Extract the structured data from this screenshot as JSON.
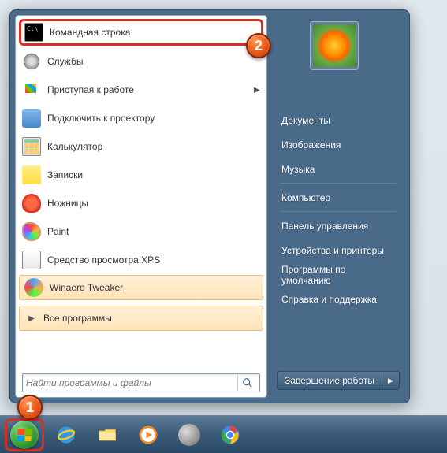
{
  "programs": [
    {
      "label": "Командная строка",
      "icon": "cmd",
      "highlighted": true
    },
    {
      "label": "Службы",
      "icon": "gear"
    },
    {
      "label": "Приступая к работе",
      "icon": "flag",
      "arrow": true
    },
    {
      "label": "Подключить к проектору",
      "icon": "proj"
    },
    {
      "label": "Калькулятор",
      "icon": "calc"
    },
    {
      "label": "Записки",
      "icon": "note"
    },
    {
      "label": "Ножницы",
      "icon": "snip"
    },
    {
      "label": "Paint",
      "icon": "paint"
    },
    {
      "label": "Средство просмотра XPS",
      "icon": "xps"
    },
    {
      "label": "Winaero Tweaker",
      "icon": "tweak",
      "pinned": true
    }
  ],
  "all_programs": {
    "label": "Все программы"
  },
  "search": {
    "placeholder": "Найти программы и файлы"
  },
  "right": {
    "username": "",
    "items": [
      "Документы",
      "Изображения",
      "Музыка",
      "Компьютер",
      "Панель управления",
      "Устройства и принтеры",
      "Программы по умолчанию",
      "Справка и поддержка"
    ]
  },
  "shutdown": {
    "label": "Завершение работы"
  },
  "callouts": {
    "c1": "1",
    "c2": "2"
  }
}
